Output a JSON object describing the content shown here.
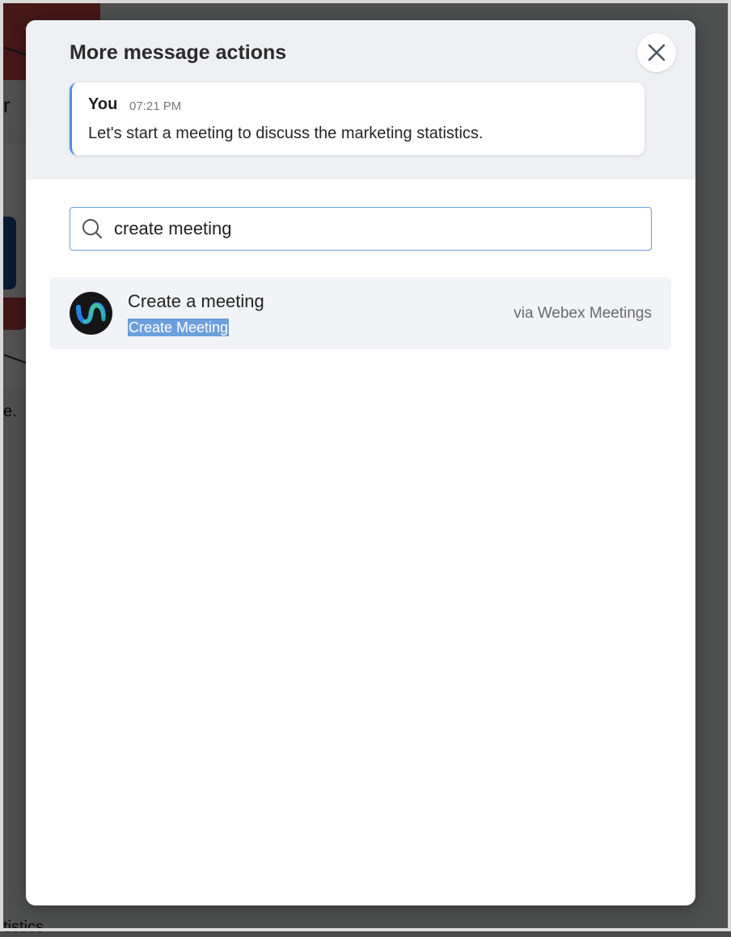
{
  "background": {
    "partial_text_top": "r n",
    "partial_text_mid": "e.",
    "partial_text_bottom": "tistics"
  },
  "modal": {
    "title": "More message actions",
    "close_icon": "close-icon",
    "message": {
      "sender": "You",
      "time": "07:21 PM",
      "text": "Let's start a meeting to discuss the marketing statistics."
    },
    "search": {
      "icon": "search-icon",
      "value": "create meeting"
    },
    "results": [
      {
        "icon": "webex-logo-icon",
        "title": "Create a meeting",
        "subtitle": "Create Meeting",
        "source": "via Webex Meetings"
      }
    ]
  },
  "colors": {
    "accent": "#4a90e2",
    "header_bg": "#eef0f4",
    "highlight": "#6c9fdc"
  }
}
